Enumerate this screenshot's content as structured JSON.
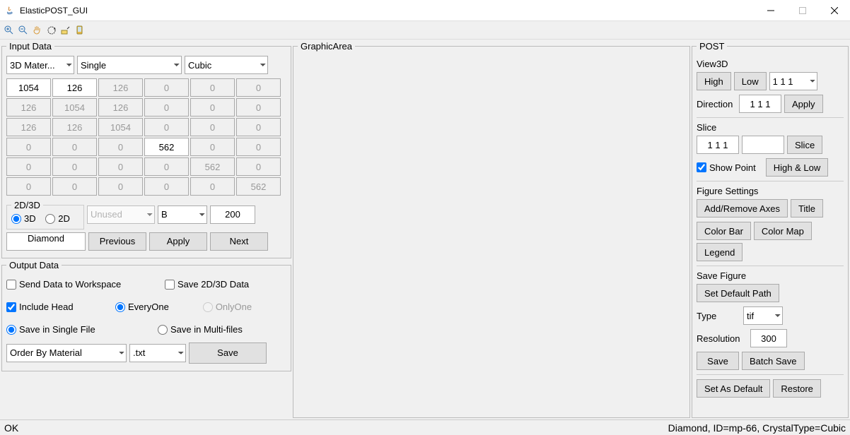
{
  "window": {
    "title": "ElasticPOST_GUI"
  },
  "input": {
    "legend": "Input Data",
    "material_select": "3D Mater...",
    "count_select": "Single",
    "crystal_select": "Cubic",
    "matrix": [
      [
        {
          "v": "1054",
          "e": true
        },
        {
          "v": "126",
          "e": true
        },
        {
          "v": "126",
          "e": false
        },
        {
          "v": "0",
          "e": false
        },
        {
          "v": "0",
          "e": false
        },
        {
          "v": "0",
          "e": false
        }
      ],
      [
        {
          "v": "126",
          "e": false
        },
        {
          "v": "1054",
          "e": false
        },
        {
          "v": "126",
          "e": false
        },
        {
          "v": "0",
          "e": false
        },
        {
          "v": "0",
          "e": false
        },
        {
          "v": "0",
          "e": false
        }
      ],
      [
        {
          "v": "126",
          "e": false
        },
        {
          "v": "126",
          "e": false
        },
        {
          "v": "1054",
          "e": false
        },
        {
          "v": "0",
          "e": false
        },
        {
          "v": "0",
          "e": false
        },
        {
          "v": "0",
          "e": false
        }
      ],
      [
        {
          "v": "0",
          "e": false
        },
        {
          "v": "0",
          "e": false
        },
        {
          "v": "0",
          "e": false
        },
        {
          "v": "562",
          "e": true
        },
        {
          "v": "0",
          "e": false
        },
        {
          "v": "0",
          "e": false
        }
      ],
      [
        {
          "v": "0",
          "e": false
        },
        {
          "v": "0",
          "e": false
        },
        {
          "v": "0",
          "e": false
        },
        {
          "v": "0",
          "e": false
        },
        {
          "v": "562",
          "e": false
        },
        {
          "v": "0",
          "e": false
        }
      ],
      [
        {
          "v": "0",
          "e": false
        },
        {
          "v": "0",
          "e": false
        },
        {
          "v": "0",
          "e": false
        },
        {
          "v": "0",
          "e": false
        },
        {
          "v": "0",
          "e": false
        },
        {
          "v": "562",
          "e": false
        }
      ]
    ],
    "dim": {
      "legend": "2D/3D",
      "opt_3d": "3D",
      "opt_2d": "2D"
    },
    "unused_select": "Unused",
    "prop_select": "B",
    "prop_value": "200",
    "name": "Diamond",
    "prev_btn": "Previous",
    "apply_btn": "Apply",
    "next_btn": "Next"
  },
  "output": {
    "legend": "Output Data",
    "send_workspace": "Send Data to Workspace",
    "save_2d3d": "Save 2D/3D Data",
    "include_head": "Include Head",
    "everyone": "EveryOne",
    "onlyone": "OnlyOne",
    "save_single": "Save in Single File",
    "save_multi": "Save in Multi-files",
    "order_select": "Order By Material",
    "ext_select": ".txt",
    "save_btn": "Save"
  },
  "graphic": {
    "legend": "GraphicArea"
  },
  "post": {
    "legend": "POST",
    "view3d": {
      "hdr": "View3D",
      "high": "High",
      "low": "Low",
      "hkl_select": "1 1 1",
      "direction_label": "Direction",
      "direction": "1 1 1",
      "apply": "Apply"
    },
    "slice": {
      "hdr": "Slice",
      "hkl": "1 1 1",
      "val2": "",
      "slice_btn": "Slice",
      "show_point": "Show Point",
      "high_low": "High & Low"
    },
    "figure": {
      "hdr": "Figure Settings",
      "axes": "Add/Remove Axes",
      "title": "Title",
      "colorbar": "Color Bar",
      "colormap": "Color Map",
      "legend": "Legend"
    },
    "save": {
      "hdr": "Save Figure",
      "default_path": "Set Default Path",
      "type_label": "Type",
      "type_select": "tif",
      "res_label": "Resolution",
      "res_value": "300",
      "save_btn": "Save",
      "batch_btn": "Batch Save"
    },
    "bottom": {
      "set_default": "Set As Default",
      "restore": "Restore"
    }
  },
  "status": {
    "left": "OK",
    "right": "Diamond, ID=mp-66, CrystalType=Cubic"
  }
}
